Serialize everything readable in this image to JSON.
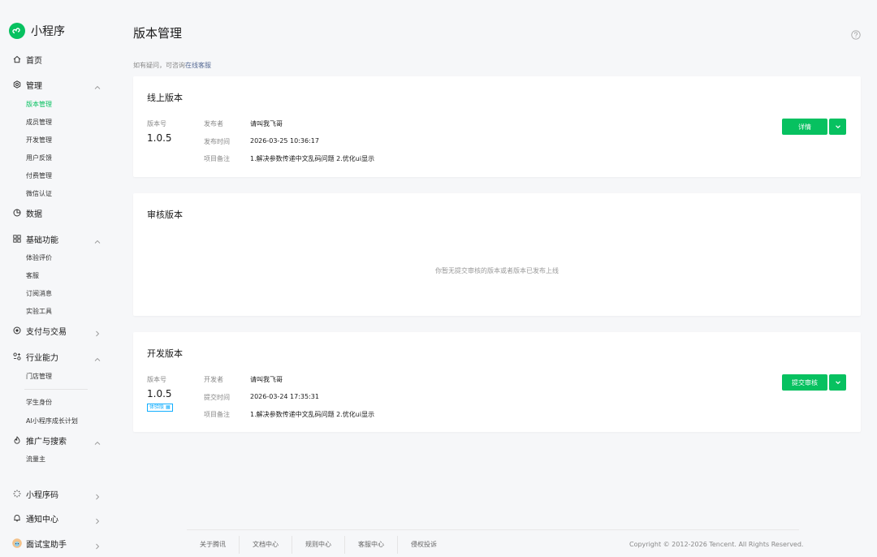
{
  "app": {
    "name": "小程序"
  },
  "sidebar": {
    "home": "首页",
    "manage": {
      "label": "管理",
      "items": [
        "版本管理",
        "成员管理",
        "开发管理",
        "用户反馈",
        "付费管理",
        "微信认证"
      ]
    },
    "data": "数据",
    "basic": {
      "label": "基础功能",
      "items": [
        "体验评价",
        "客服",
        "订阅消息",
        "实验工具"
      ]
    },
    "payment": "支付与交易",
    "industry": {
      "label": "行业能力",
      "items": [
        "门店管理",
        "学生身份",
        "AI小程序成长计划"
      ]
    },
    "promote": {
      "label": "推广与搜索",
      "items": [
        "流量主"
      ]
    },
    "qrcode": "小程序码",
    "notify": "通知中心",
    "assistant": "面试宝助手"
  },
  "header": {
    "title": "版本管理",
    "hint_prefix": "如有疑问，可咨询",
    "hint_link": "在线客服"
  },
  "online": {
    "title": "线上版本",
    "version_label": "版本号",
    "version": "1.0.5",
    "rows": [
      {
        "key": "发布者",
        "value": "请叫我飞哥"
      },
      {
        "key": "发布时间",
        "value": "2026-03-25 10:36:17"
      },
      {
        "key": "项目备注",
        "value": "1.解决参数传递中文乱码问题 2.优化ui显示"
      }
    ],
    "button": "详情"
  },
  "review": {
    "title": "审核版本",
    "empty": "你暂无提交审核的版本或者版本已发布上线"
  },
  "dev": {
    "title": "开发版本",
    "version_label": "版本号",
    "version": "1.0.5",
    "badge": "体验版",
    "rows": [
      {
        "key": "开发者",
        "value": "请叫我飞哥"
      },
      {
        "key": "提交时间",
        "value": "2026-03-24 17:35:31"
      },
      {
        "key": "项目备注",
        "value": "1.解决参数传递中文乱码问题 2.优化ui显示"
      }
    ],
    "button": "提交审核"
  },
  "footer": {
    "links": [
      "关于腾讯",
      "文档中心",
      "规则中心",
      "客服中心",
      "侵权投诉"
    ],
    "copyright": "Copyright © 2012-2026 Tencent. All Rights Reserved."
  },
  "colors": {
    "accent": "#07c160",
    "link": "#576b95",
    "badge": "#10aeff"
  }
}
